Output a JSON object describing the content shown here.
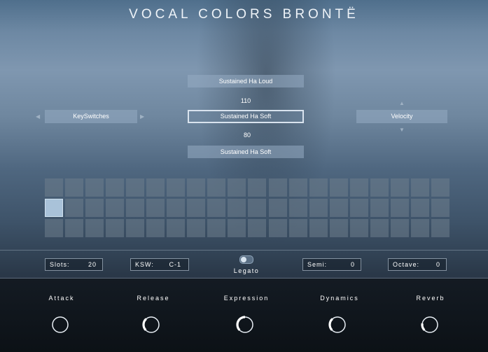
{
  "app": {
    "title": "VOCAL COLORS BRONTË"
  },
  "articulation": {
    "above": "Sustained Ha Loud",
    "upper_value": "110",
    "current": "Sustained Ha Soft",
    "lower_value": "80",
    "below": "Sustained Ha Soft"
  },
  "left_selector": {
    "label": "KeySwitches"
  },
  "right_selector": {
    "label": "Velocity"
  },
  "slot_grid": {
    "columns": 20,
    "rows": 3,
    "selected_row": 1,
    "selected_col": 0
  },
  "settings": {
    "slots_label": "Slots:",
    "slots_value": "20",
    "ksw_label": "KSW:",
    "ksw_value": "C-1",
    "legato_label": "Legato",
    "legato_on": false,
    "semi_label": "Semi:",
    "semi_value": "0",
    "octave_label": "Octave:",
    "octave_value": "0"
  },
  "knobs": [
    {
      "label": "Attack",
      "value": 0.0
    },
    {
      "label": "Release",
      "value": 0.35
    },
    {
      "label": "Expression",
      "value": 0.5
    },
    {
      "label": "Dynamics",
      "value": 0.35
    },
    {
      "label": "Reverb",
      "value": 0.2
    }
  ],
  "colors": {
    "accent": "#d9e3ee",
    "selected_slot": "#a9c2d9",
    "panel_dark": "#0c1116"
  }
}
